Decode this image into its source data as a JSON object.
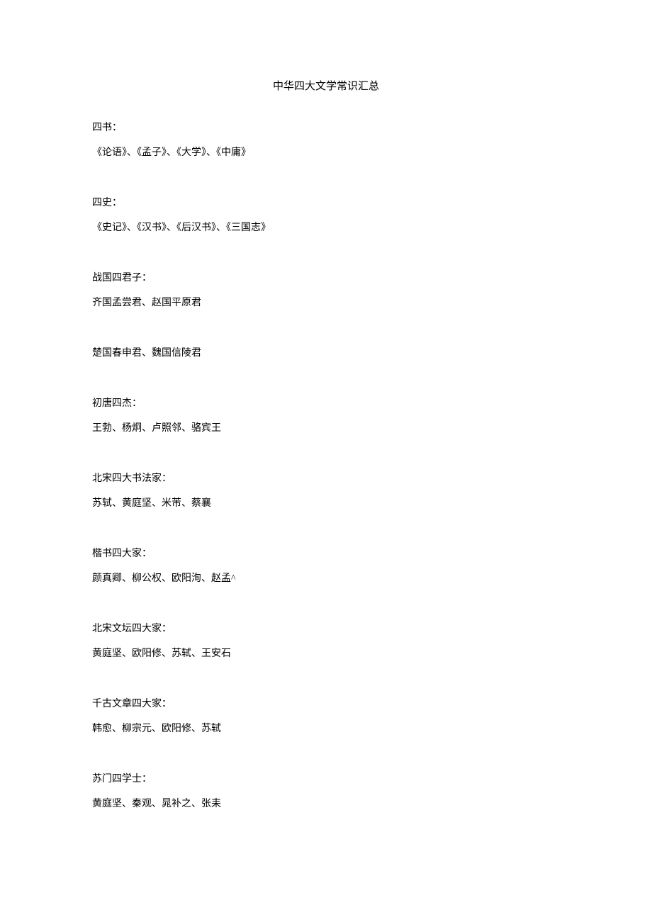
{
  "title": "中华四大文学常识汇总",
  "sections": [
    {
      "heading": "四书：",
      "content": "《论语》、《孟子》、《大学》、《中庸》"
    },
    {
      "heading": "四史：",
      "content": "《史记》、《汉书》、《后汉书》、《三国志》"
    },
    {
      "heading": "战国四君子：",
      "content": "齐国孟尝君、赵国平原君"
    },
    {
      "heading": "",
      "content": "楚国春申君、魏国信陵君"
    },
    {
      "heading": "初唐四杰：",
      "content": "王勃、杨炯、卢照邻、骆宾王"
    },
    {
      "heading": "北宋四大书法家：",
      "content": "苏轼、黄庭坚、米芾、蔡襄"
    },
    {
      "heading": "楷书四大家：",
      "content": "颜真卿、柳公权、欧阳洵、赵孟^"
    },
    {
      "heading": "北宋文坛四大家：",
      "content": "黄庭坚、欧阳修、苏轼、王安石"
    },
    {
      "heading": "千古文章四大家：",
      "content": "韩愈、柳宗元、欧阳修、苏轼"
    },
    {
      "heading": "苏门四学士：",
      "content": "黄庭坚、秦观、晁补之、张耒"
    }
  ]
}
